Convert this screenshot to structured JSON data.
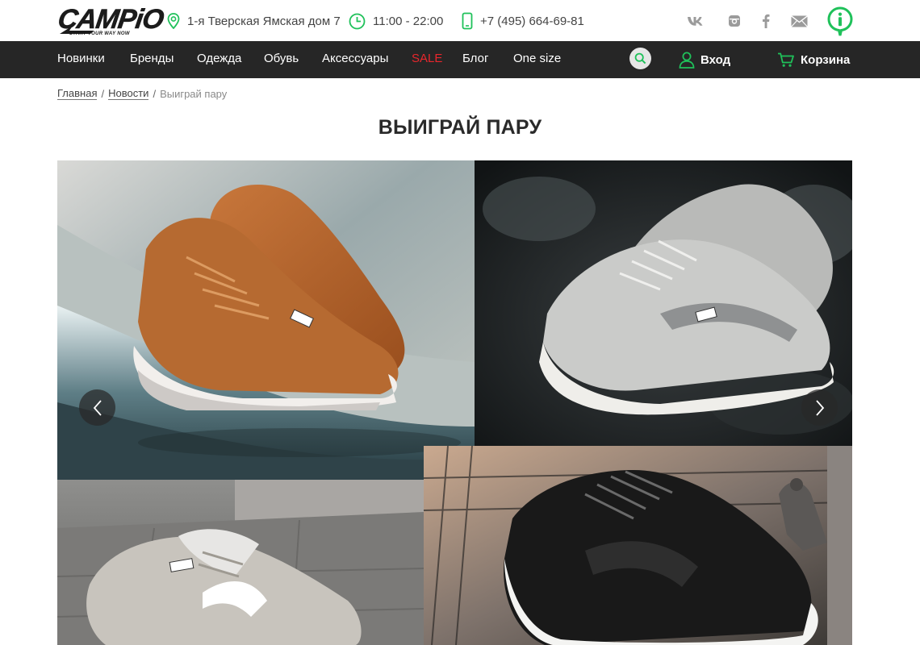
{
  "header": {
    "logo_text": "CAMPiO",
    "logo_tagline": "START YOUR WAY NOW",
    "address": "1-я Тверская Ямская дом 7",
    "hours": "11:00 - 22:00",
    "phone": "+7 (495) 664-69-81",
    "social": [
      "vk-icon",
      "instagram-icon",
      "facebook-icon",
      "mail-icon"
    ],
    "info_icon": "info-icon"
  },
  "nav": {
    "items": [
      {
        "label": "Новинки"
      },
      {
        "label": "Бренды"
      },
      {
        "label": "Одежда"
      },
      {
        "label": "Обувь"
      },
      {
        "label": "Аксессуары"
      },
      {
        "label": "SALE"
      },
      {
        "label": "Блог"
      },
      {
        "label": "One size"
      }
    ],
    "login_label": "Вход",
    "cart_label": "Корзина"
  },
  "breadcrumb": {
    "home": "Главная",
    "news": "Новости",
    "current": "Выиграй пару",
    "separator": "/"
  },
  "page": {
    "title": "ВЫИГРАЙ ПАРУ"
  },
  "colors": {
    "accent": "#1fc15a",
    "nav_bg": "#262626",
    "sale": "#e8262c",
    "text": "#333333"
  }
}
